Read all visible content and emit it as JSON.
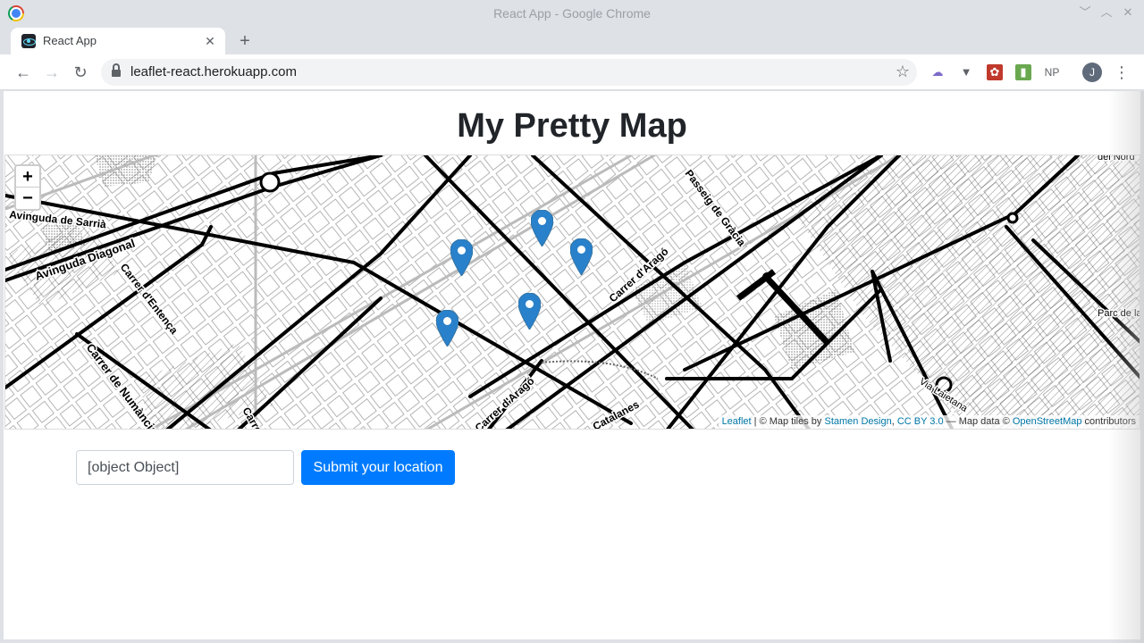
{
  "window": {
    "title": "React App - Google Chrome"
  },
  "tabs": [
    {
      "title": "React App"
    }
  ],
  "toolbar": {
    "url": "leaflet-react.herokuapp.com",
    "avatar_letter": "J",
    "ext_np": "NP"
  },
  "page": {
    "title": "My Pretty Map",
    "map": {
      "zoom_in": "+",
      "zoom_out": "−",
      "street_labels": [
        "Avinguda de Sarrià",
        "Avinguda Diagonal",
        "Carrer d'Entença",
        "Carrer de Numància",
        "Carrer",
        "Passeig de Gràcia",
        "Carrer d'Aragó",
        "Carrer d'Aragó",
        "Catalanes",
        "Via Laietana",
        "Parc de la",
        "del Nord"
      ],
      "markers_count": 5,
      "attribution": {
        "leaflet": "Leaflet",
        "text1": " | © Map tiles by ",
        "stamen": "Stamen Design",
        "sep": ", ",
        "cc": "CC BY 3.0",
        "text2": " — Map data © ",
        "osm": "OpenStreetMap",
        "text3": " contributors"
      }
    },
    "form": {
      "input_value": "[object Object]",
      "submit_label": "Submit your location"
    }
  },
  "colors": {
    "marker": "#2a81cb",
    "button": "#007bff"
  }
}
